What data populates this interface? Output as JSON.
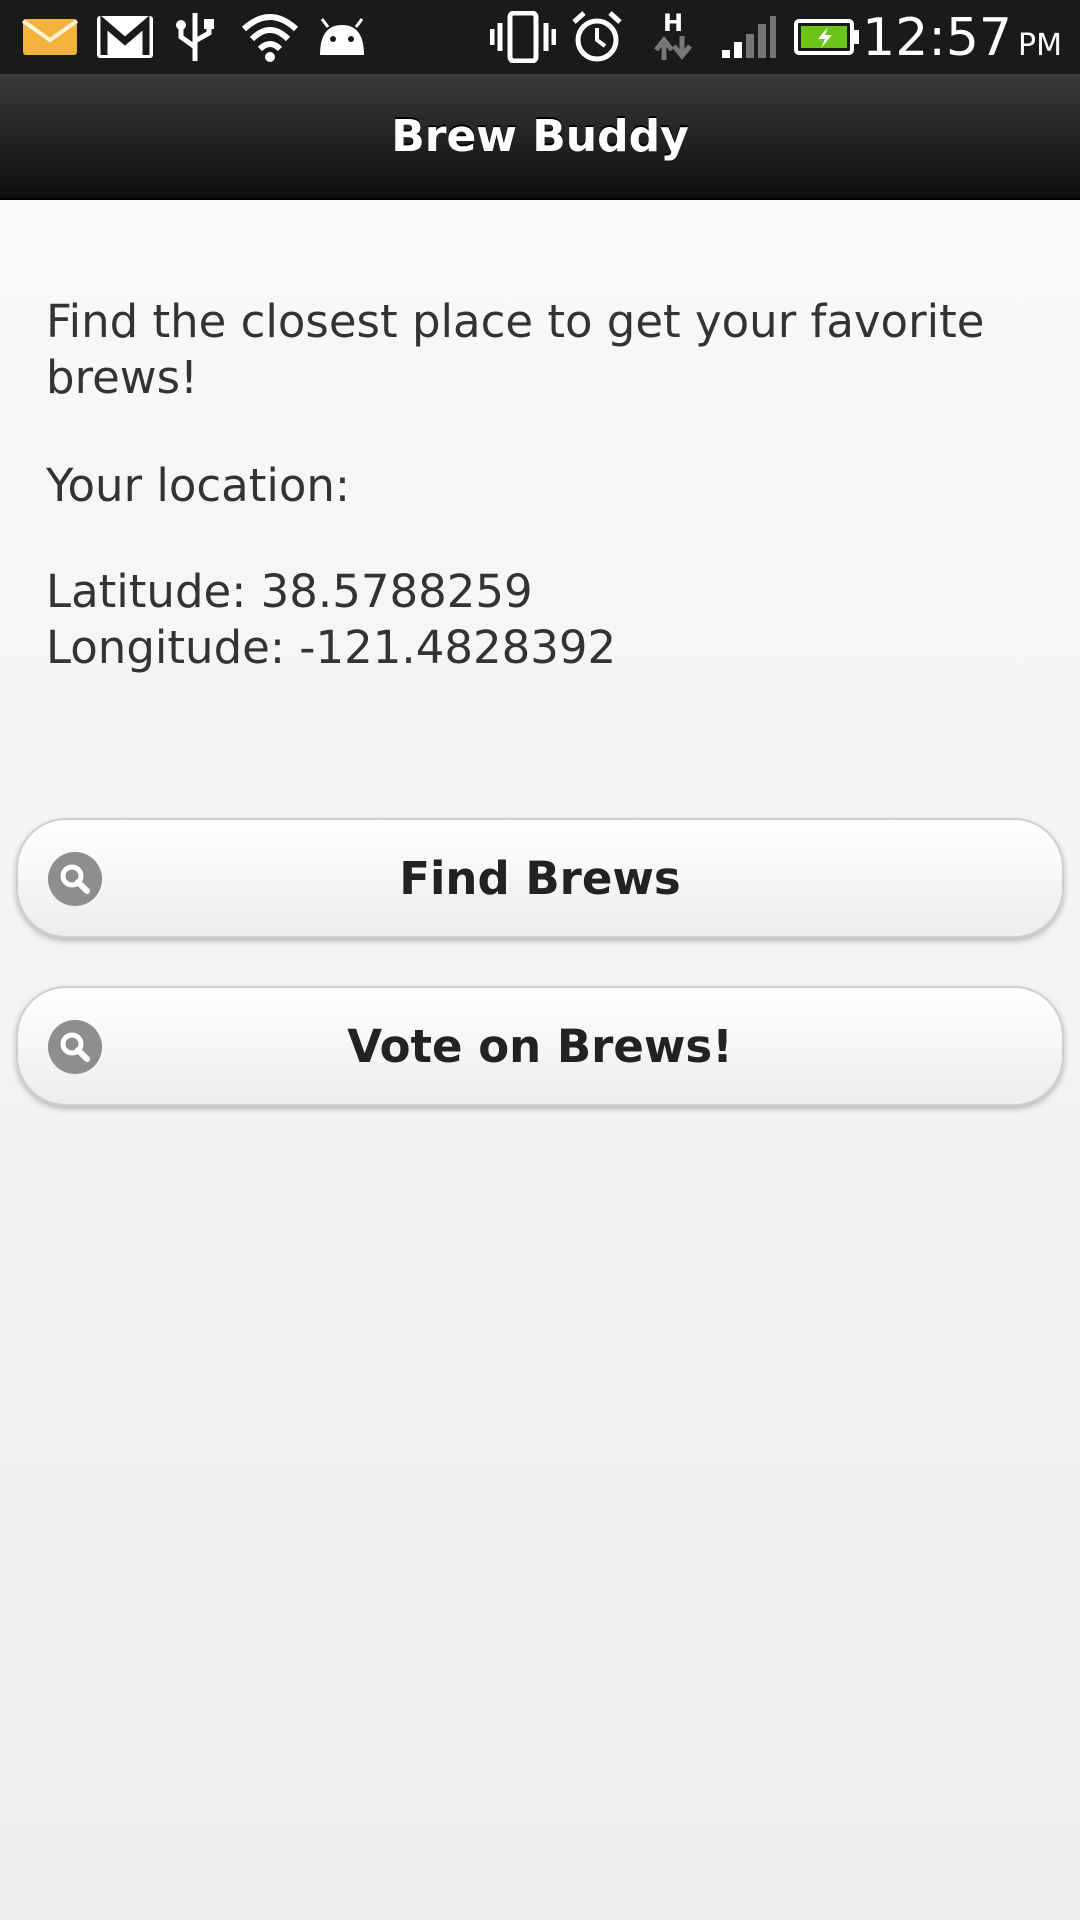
{
  "status_bar": {
    "time": "12:57",
    "ampm": "PM",
    "network_label": "H",
    "icons": [
      "email-icon",
      "gmail-icon",
      "usb-icon",
      "wifi-icon",
      "android-debug-icon",
      "vibrate-icon",
      "alarm-icon",
      "network-h-icon",
      "signal-icon",
      "battery-charging-icon"
    ]
  },
  "header": {
    "title": "Brew Buddy"
  },
  "main": {
    "intro": "Find the closest place to get your favorite brews!",
    "location_label": "Your location:",
    "latitude": "Latitude: 38.5788259",
    "longitude": "Longitude: -121.4828392"
  },
  "buttons": [
    {
      "label": "Find Brews",
      "icon": "search-icon"
    },
    {
      "label": "Vote on Brews!",
      "icon": "search-icon"
    }
  ],
  "colors": {
    "header_bg": "#1a1a1a",
    "battery_green": "#6cc516",
    "text": "#333333"
  }
}
